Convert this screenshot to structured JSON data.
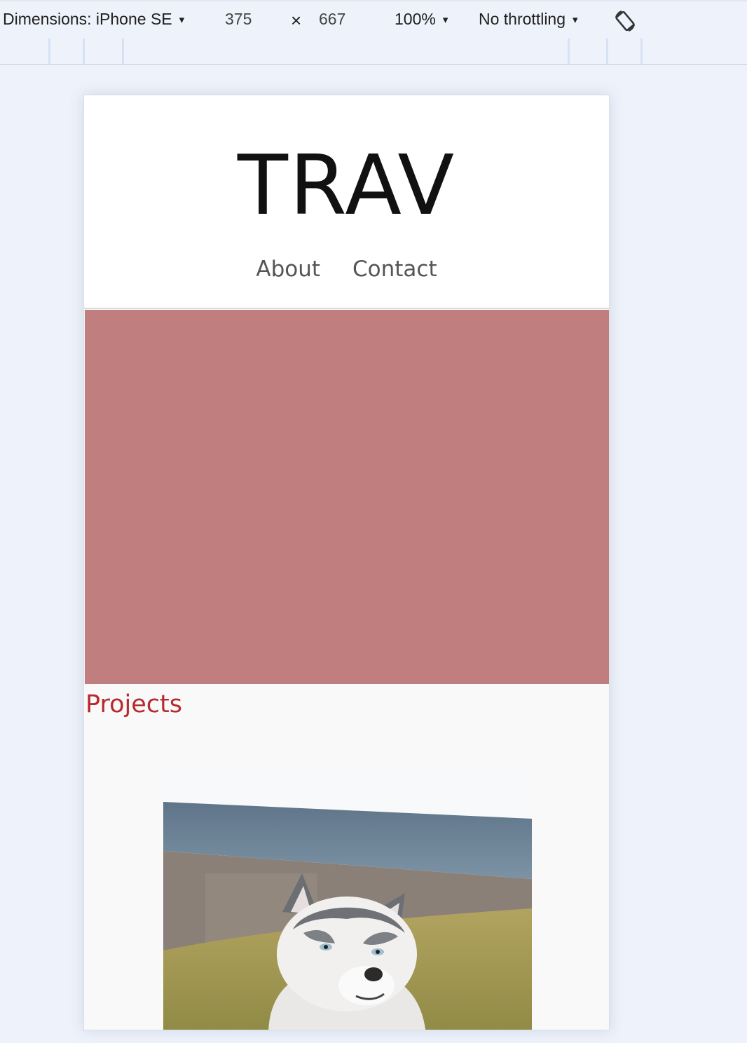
{
  "devtools": {
    "device_label": "Dimensions: iPhone SE",
    "width": "375",
    "times": "×",
    "height": "667",
    "zoom": "100%",
    "throttling": "No throttling",
    "caret": "▾"
  },
  "site": {
    "logo": "TRAV",
    "nav": [
      "About",
      "Contact"
    ],
    "projects_heading": "Projects",
    "hero_color": "#c07f7e",
    "accent_color": "#b72a2d"
  },
  "photo": {
    "alt": "Husky dog portrait",
    "icon": "husky-photo"
  }
}
